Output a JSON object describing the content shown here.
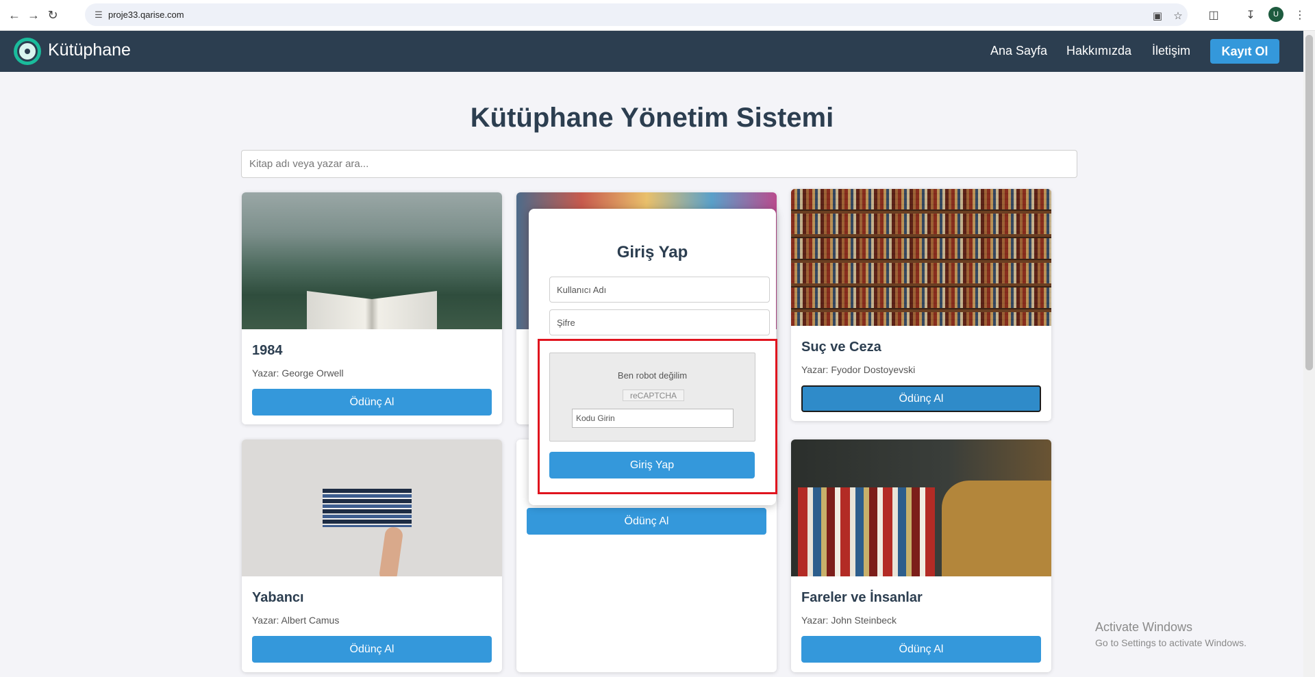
{
  "browser": {
    "url": "proje33.qarise.com",
    "avatar_letter": "U"
  },
  "navbar": {
    "brand": "Kütüphane",
    "links": [
      "Ana Sayfa",
      "Hakkımızda",
      "İletişim"
    ],
    "register": "Kayıt Ol"
  },
  "main": {
    "title": "Kütüphane Yönetim Sistemi",
    "search_placeholder": "Kitap adı veya yazar ara..."
  },
  "books": [
    {
      "title": "1984",
      "author": "Yazar: George Orwell",
      "button": "Ödünç Al"
    },
    {
      "title": "",
      "author": "",
      "button": ""
    },
    {
      "title": "Suç ve Ceza",
      "author": "Yazar: Fyodor Dostoyevski",
      "button": "Ödünç Al"
    },
    {
      "title": "Yabancı",
      "author": "Yazar: Albert Camus",
      "button": "Ödünç Al"
    },
    {
      "title": "",
      "author": "",
      "button": "Ödünç Al"
    },
    {
      "title": "Fareler ve İnsanlar",
      "author": "Yazar: John Steinbeck",
      "button": "Ödünç Al"
    }
  ],
  "login_modal": {
    "title": "Giriş Yap",
    "username_placeholder": "Kullanıcı Adı",
    "password_placeholder": "Şifre",
    "captcha_label": "Ben robot değilim",
    "captcha_image_alt": "reCAPTCHA",
    "captcha_input_placeholder": "Kodu Girin",
    "submit": "Giriş Yap"
  },
  "watermark": {
    "line1": "Activate Windows",
    "line2": "Go to Settings to activate Windows."
  },
  "colors": {
    "navbar": "#2c3e50",
    "accent": "#3498db",
    "highlight": "#e0141e"
  }
}
